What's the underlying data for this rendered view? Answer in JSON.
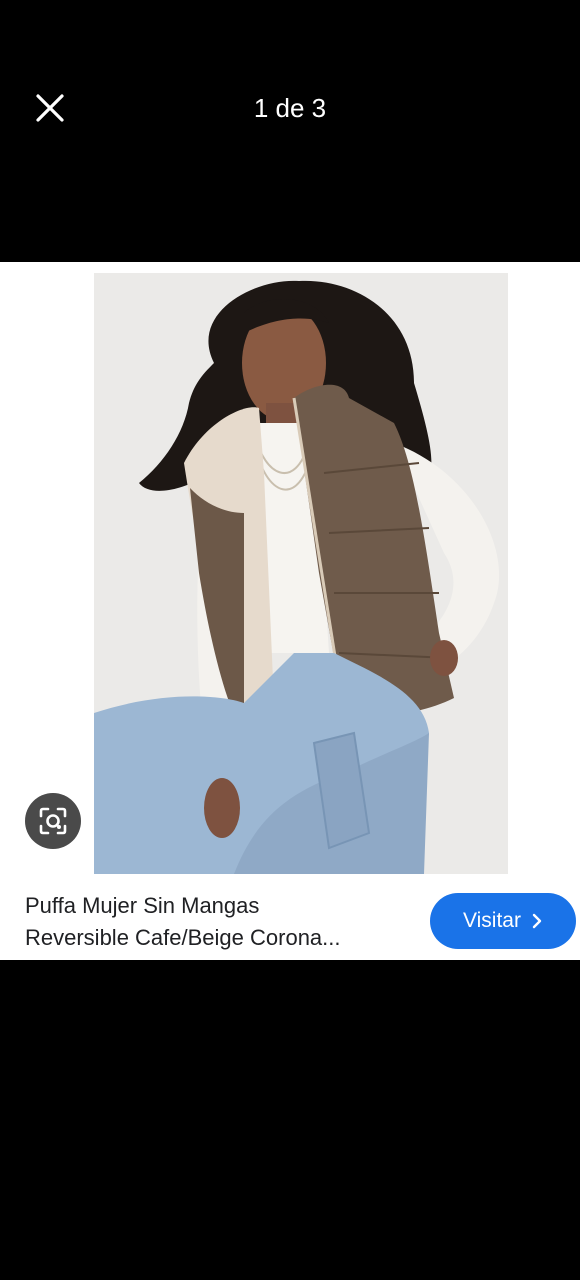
{
  "header": {
    "counter": "1 de 3",
    "close_icon": "close-icon"
  },
  "result": {
    "image_description_icon": "product-photo",
    "lens_icon": "lens-search-icon",
    "title_line1": "Puffa Mujer Sin Mangas",
    "title_line2": "Reversible Cafe/Beige Corona...",
    "visit_label": "Visitar",
    "visit_icon": "chevron-right-icon"
  },
  "colors": {
    "background": "#000000",
    "accent": "#1a73e8",
    "card": "#ffffff"
  }
}
